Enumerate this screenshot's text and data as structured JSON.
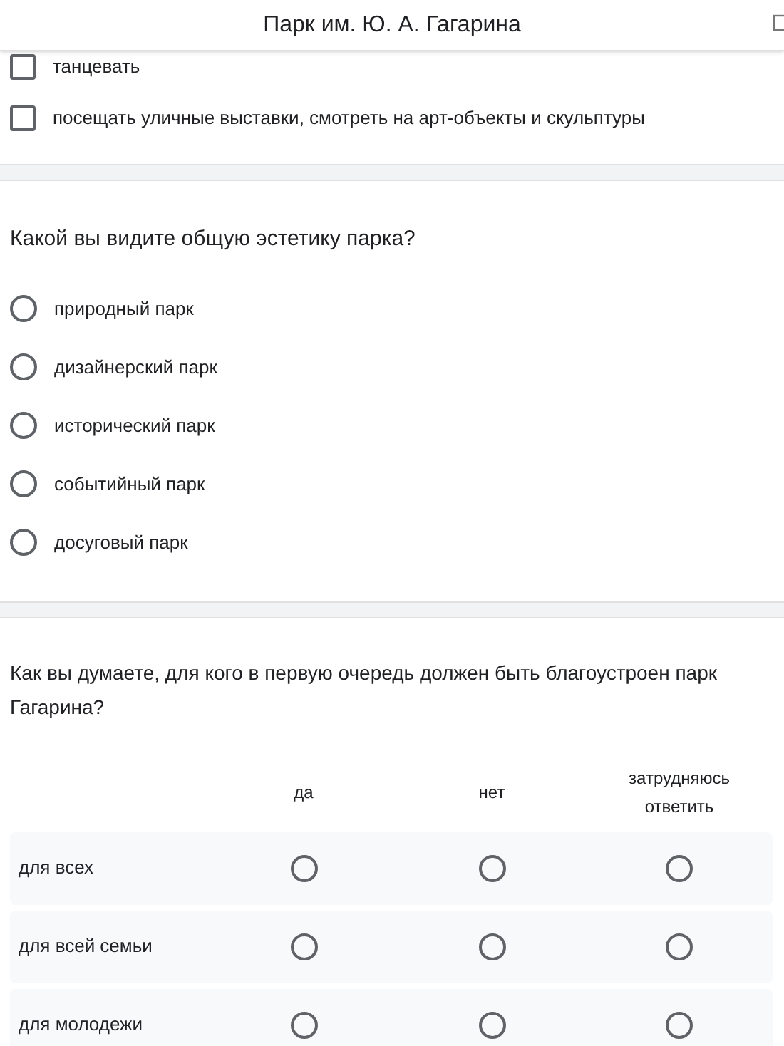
{
  "header": {
    "title": "Парк им. Ю. А. Гагарина"
  },
  "checkbox_options": [
    {
      "label": "танцевать",
      "checked": false
    },
    {
      "label": "посещать уличные выставки, смотреть на арт-объекты и скульптуры",
      "checked": false
    }
  ],
  "question_1": {
    "title": "Какой вы видите общую эстетику парка?",
    "options": [
      {
        "label": "природный парк",
        "selected": false
      },
      {
        "label": "дизайнерский парк",
        "selected": false
      },
      {
        "label": "исторический парк",
        "selected": false
      },
      {
        "label": "событийный парк",
        "selected": false
      },
      {
        "label": "досуговый парк",
        "selected": false
      }
    ]
  },
  "question_2": {
    "title": "Как вы думаете, для кого в первую очередь должен быть благоустроен парк Гагарина?",
    "columns": [
      "да",
      "нет",
      "затрудняюсь ответить"
    ],
    "rows": [
      {
        "label": "для всех",
        "choices": [
          {
            "selected": false
          },
          {
            "selected": false
          },
          {
            "selected": false
          }
        ]
      },
      {
        "label": "для всей семьи",
        "choices": [
          {
            "selected": false
          },
          {
            "selected": false
          },
          {
            "selected": false
          }
        ]
      },
      {
        "label": "для молодежи",
        "choices": [
          {
            "selected": false
          },
          {
            "selected": false
          },
          {
            "selected": false
          }
        ]
      }
    ]
  }
}
